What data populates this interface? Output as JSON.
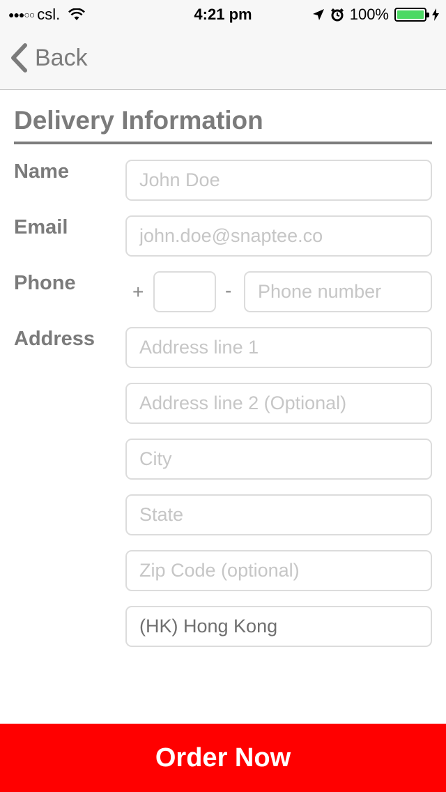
{
  "status_bar": {
    "carrier": "csl.",
    "signal": "●●●○○",
    "time": "4:21 pm",
    "battery": "100%",
    "icons": [
      "wifi-icon",
      "location-arrow-icon",
      "alarm-clock-icon",
      "battery-icon",
      "charging-bolt-icon"
    ],
    "battery_level": 1.0,
    "battery_color": "#4cd964"
  },
  "nav": {
    "back_label": "Back",
    "back_icon": "chevron-left-icon"
  },
  "section": {
    "title": "Delivery Information"
  },
  "form": {
    "name": {
      "label": "Name",
      "placeholder": "John Doe"
    },
    "email": {
      "label": "Email",
      "placeholder": "john.doe@snaptee.co"
    },
    "phone": {
      "label": "Phone",
      "plus": "+",
      "dash": "-",
      "code_placeholder": "",
      "number_placeholder": "Phone number"
    },
    "address": {
      "label": "Address",
      "line1_placeholder": "Address line 1",
      "line2_placeholder": "Address line 2 (Optional)",
      "city_placeholder": "City",
      "state_placeholder": "State",
      "zip_placeholder": "Zip Code (optional)",
      "country_value": "(HK) Hong Kong"
    }
  },
  "order_button": {
    "label": "Order Now",
    "color": "#ff0000"
  }
}
